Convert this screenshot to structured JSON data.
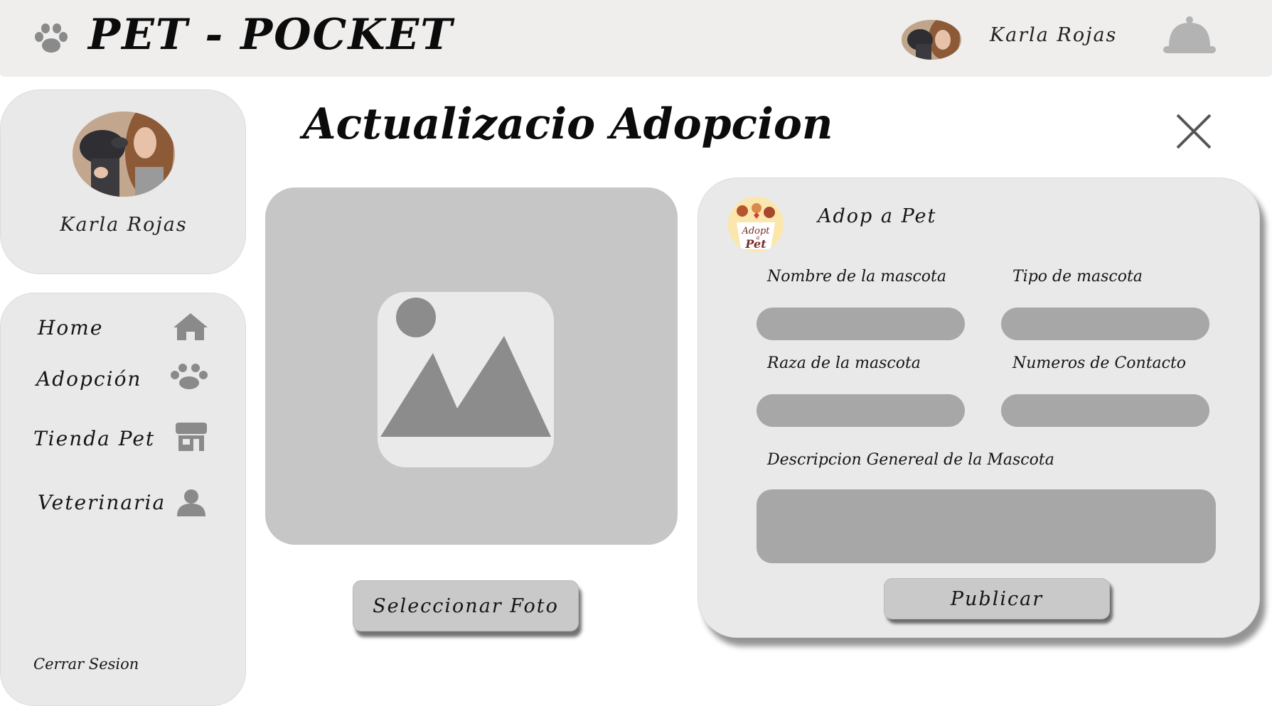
{
  "app": {
    "brand_title": "PET - POCKET"
  },
  "header": {
    "user_name": "Karla Rojas"
  },
  "sidebar": {
    "profile_name": "Karla Rojas",
    "items": [
      {
        "label": "Home",
        "icon": "home-icon"
      },
      {
        "label": "Adopción",
        "icon": "paw-icon"
      },
      {
        "label": "Tienda Pet",
        "icon": "store-icon"
      },
      {
        "label": "Veterinaria",
        "icon": "person-icon"
      }
    ],
    "logout_label": "Cerrar Sesion"
  },
  "main": {
    "page_title": "Actualizacio Adopcion",
    "select_photo_label": "Seleccionar Foto"
  },
  "form": {
    "org_name": "Adop a Pet",
    "logo_text_top": "Adopt",
    "logo_text_mid": "a",
    "logo_text_bottom": "Pet",
    "fields": {
      "pet_name_label": "Nombre de la mascota",
      "pet_type_label": "Tipo de mascota",
      "pet_breed_label": "Raza de la mascota",
      "contact_label": "Numeros de Contacto",
      "description_label": "Descripcion Genereal de la Mascota"
    },
    "publish_label": "Publicar"
  },
  "colors": {
    "header_bg": "#efeeed",
    "card_bg": "#e9e9e9",
    "input_bg": "#a7a7a7",
    "photo_bg": "#c6c6c6",
    "button_bg": "#c9c9c9",
    "icon_gray": "#8a8a8a"
  }
}
